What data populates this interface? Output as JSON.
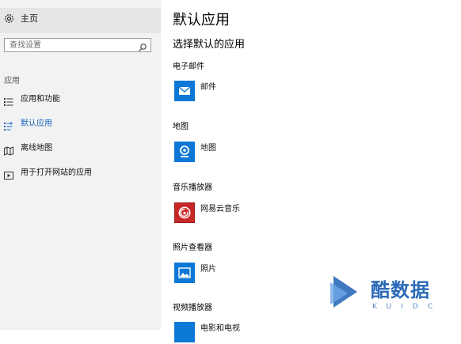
{
  "colors": {
    "accent": "#1e6fc7",
    "tile_blue": "#0b78d7",
    "tile_red": "#c62828",
    "sidebar_bg": "#f2f2f2",
    "selected_text": "#1565c0"
  },
  "sidebar": {
    "home": {
      "label": "主页",
      "icon": "gear-icon"
    },
    "search": {
      "placeholder": "查找设置",
      "icon": "search-icon"
    },
    "section_label": "应用",
    "items": [
      {
        "label": "应用和功能",
        "icon": "list-icon",
        "selected": false
      },
      {
        "label": "默认应用",
        "icon": "default-apps-icon",
        "selected": true
      },
      {
        "label": "离线地图",
        "icon": "map-icon",
        "selected": false
      },
      {
        "label": "用于打开网站的应用",
        "icon": "open-website-icon",
        "selected": false
      }
    ]
  },
  "main": {
    "title": "默认应用",
    "subtitle": "选择默认的应用",
    "categories": [
      {
        "label": "电子邮件",
        "app": "邮件",
        "icon": "mail-icon"
      },
      {
        "label": "地图",
        "app": "地图",
        "icon": "maps-icon"
      },
      {
        "label": "音乐播放器",
        "app": "网易云音乐",
        "icon": "netease-music-icon"
      },
      {
        "label": "照片查看器",
        "app": "照片",
        "icon": "photos-icon"
      },
      {
        "label": "视频播放器",
        "app": "电影和电视",
        "icon": "movies-tv-icon"
      }
    ]
  },
  "watermark": {
    "text": "酷数据",
    "sub": "KUIDC"
  }
}
